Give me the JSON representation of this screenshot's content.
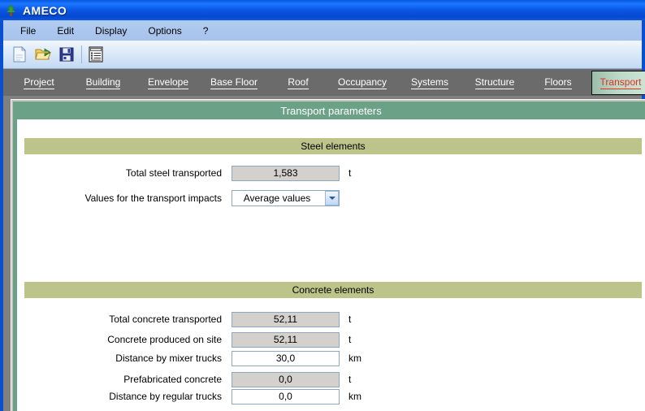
{
  "window": {
    "title": "AMECO",
    "icon": "tree-icon"
  },
  "menu": {
    "items": [
      {
        "label": "File",
        "name": "menu-file"
      },
      {
        "label": "Edit",
        "name": "menu-edit"
      },
      {
        "label": "Display",
        "name": "menu-display"
      },
      {
        "label": "Options",
        "name": "menu-options"
      },
      {
        "label": "?",
        "name": "menu-help"
      }
    ]
  },
  "toolbar": {
    "buttons": [
      {
        "icon": "new-document-icon",
        "name": "new-button"
      },
      {
        "icon": "open-folder-icon",
        "name": "open-button"
      },
      {
        "icon": "save-floppy-icon",
        "name": "save-button"
      },
      {
        "icon": "report-list-icon",
        "name": "report-button"
      }
    ]
  },
  "tabs": [
    {
      "label": "Project",
      "active": false
    },
    {
      "label": "Building",
      "active": false
    },
    {
      "label": "Envelope",
      "active": false
    },
    {
      "label": "Base Floor",
      "active": false
    },
    {
      "label": "Roof",
      "active": false
    },
    {
      "label": "Occupancy",
      "active": false
    },
    {
      "label": "Systems",
      "active": false
    },
    {
      "label": "Structure",
      "active": false
    },
    {
      "label": "Floors",
      "active": false
    },
    {
      "label": "Transport",
      "active": true
    }
  ],
  "panel": {
    "title": "Transport parameters"
  },
  "sections": {
    "steel": {
      "heading": "Steel elements",
      "rows": [
        {
          "label": "Total steel transported",
          "value": "1,583",
          "unit": "t",
          "type": "readonly",
          "name": "total-steel-transported"
        },
        {
          "label": "Values for the transport impacts",
          "value": "Average values",
          "unit": "",
          "type": "combo",
          "name": "transport-impacts-values"
        }
      ]
    },
    "concrete": {
      "heading": "Concrete elements",
      "rows": [
        {
          "label": "Total concrete transported",
          "value": "52,11",
          "unit": "t",
          "type": "readonly",
          "name": "total-concrete-transported"
        },
        {
          "label": "Concrete produced on site",
          "value": "52,11",
          "unit": "t",
          "type": "readonly",
          "name": "concrete-produced-on-site"
        },
        {
          "label": "Distance by mixer trucks",
          "value": "30,0",
          "unit": "km",
          "type": "editable",
          "name": "distance-by-mixer-trucks"
        },
        {
          "label": "Prefabricated concrete",
          "value": "0,0",
          "unit": "t",
          "type": "readonly",
          "name": "prefabricated-concrete"
        },
        {
          "label": "Distance by regular trucks",
          "value": "0,0",
          "unit": "km",
          "type": "editable",
          "name": "distance-by-regular-trucks"
        }
      ]
    }
  },
  "colors": {
    "title_bar": "#0b56e4",
    "menu_bar": "#aac6ee",
    "tab_strip": "#6b6b6b",
    "panel_header": "#6ba287",
    "section_header": "#bdc489",
    "active_tab_text": "#e03020",
    "field_border": "#8fa8c0",
    "readonly_field": "#d4d0cc"
  }
}
